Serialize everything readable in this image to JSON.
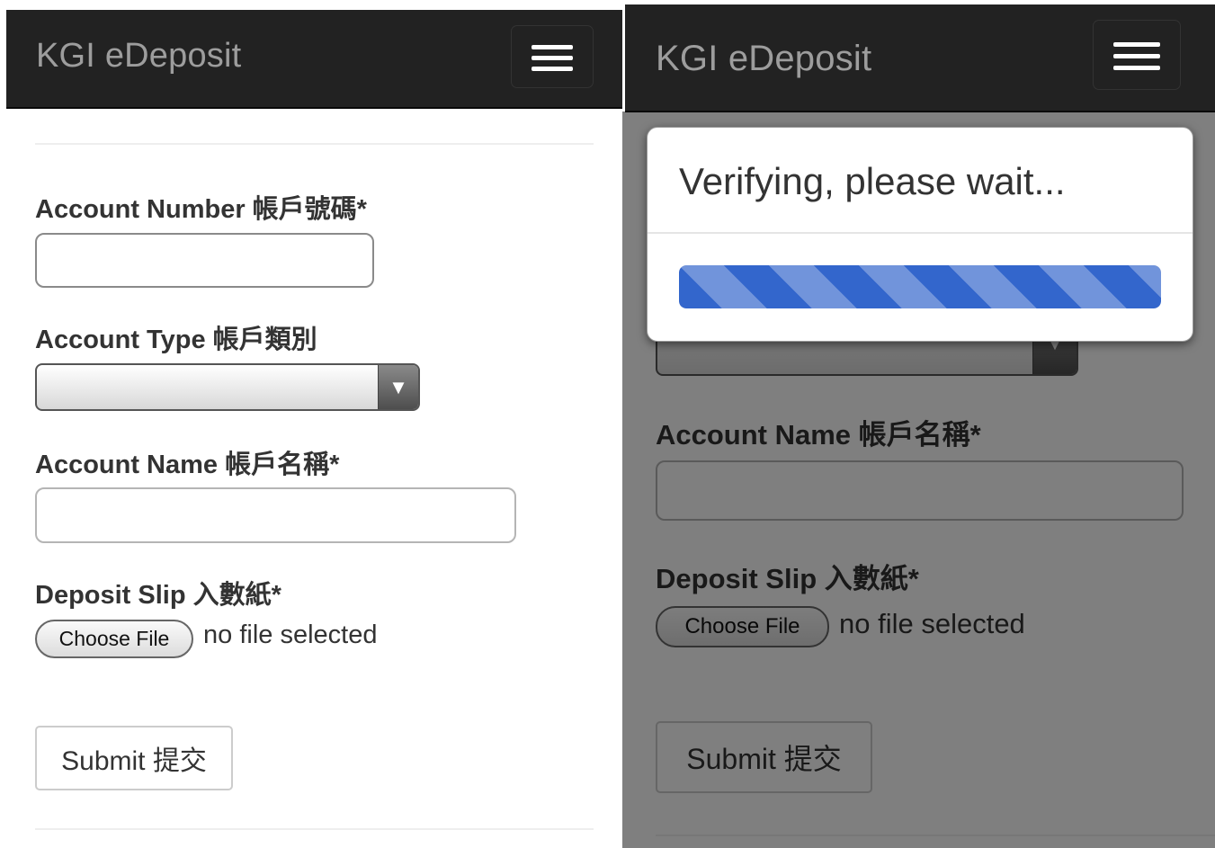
{
  "app": {
    "brand": "KGI eDeposit"
  },
  "form": {
    "account_number_label": "Account Number 帳戶號碼*",
    "account_number_value": "",
    "account_type_label": "Account Type 帳戶類別",
    "account_type_selected": "",
    "account_name_label": "Account Name 帳戶名稱*",
    "account_name_value": "",
    "deposit_slip_label": "Deposit Slip 入數紙*",
    "choose_file_label": "Choose File",
    "file_status": "no file selected",
    "submit_label": "Submit 提交"
  },
  "icons": {
    "menu": "hamburger-menu-icon",
    "select_arrow": "chevron-down-icon"
  },
  "modal": {
    "title": "Verifying, please wait...",
    "progress_percent": 100
  },
  "colors": {
    "navbar_bg": "#222222",
    "brand_text": "#9d9d9d",
    "progress_bar": "#3366cc",
    "overlay": "rgba(0,0,0,0.5)"
  }
}
